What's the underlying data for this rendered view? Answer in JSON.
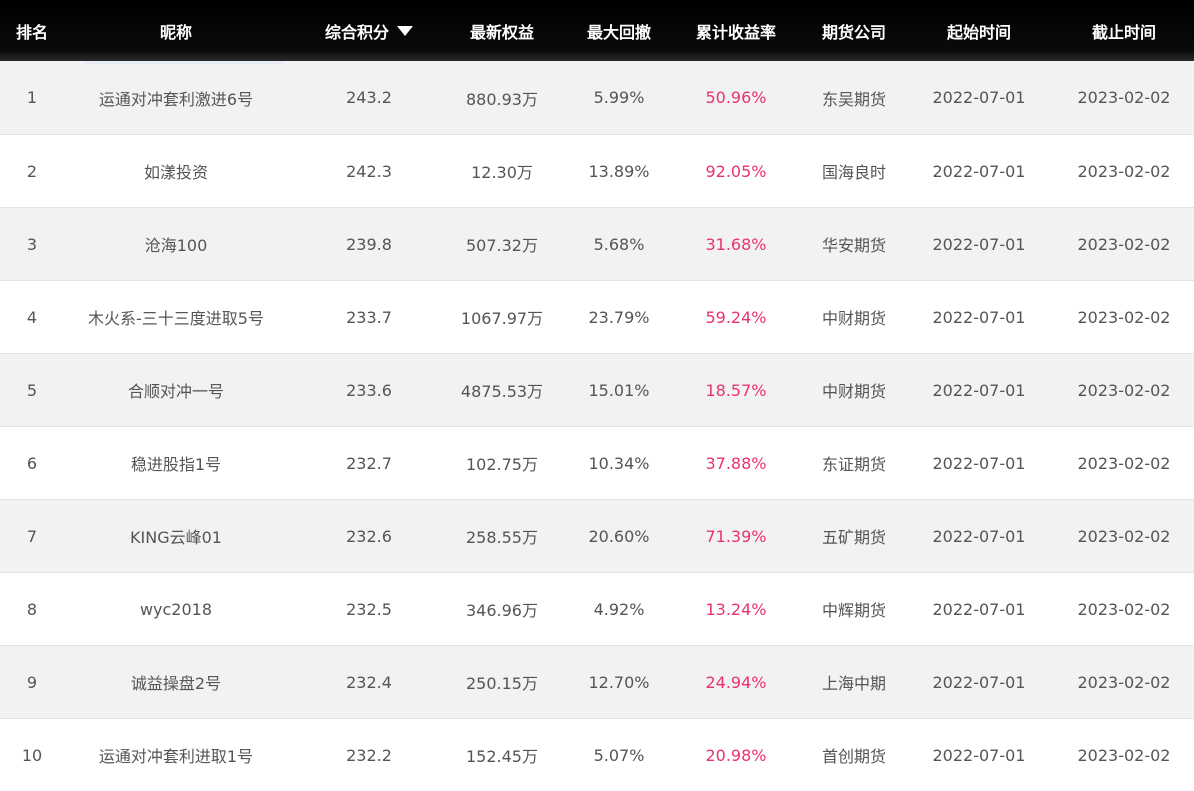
{
  "columns": {
    "rank": "排名",
    "nickname": "昵称",
    "score": "综合积分",
    "equity": "最新权益",
    "max_drawdown": "最大回撤",
    "cum_return": "累计收益率",
    "broker": "期货公司",
    "start": "起始时间",
    "end": "截止时间"
  },
  "icons": {
    "sort": "sort-desc-triangle-icon"
  },
  "colors": {
    "header_bg": "#000000",
    "return_text": "#e8336d",
    "stripe": "#f2f2f2"
  },
  "rows": [
    {
      "rank": "1",
      "nickname": "运通对冲套利激进6号",
      "score": "243.2",
      "equity": "880.93万",
      "max_drawdown": "5.99%",
      "cum_return": "50.96%",
      "broker": "东吴期货",
      "start": "2022-07-01",
      "end": "2023-02-02"
    },
    {
      "rank": "2",
      "nickname": "如漾投资",
      "score": "242.3",
      "equity": "12.30万",
      "max_drawdown": "13.89%",
      "cum_return": "92.05%",
      "broker": "国海良时",
      "start": "2022-07-01",
      "end": "2023-02-02"
    },
    {
      "rank": "3",
      "nickname": "沧海100",
      "score": "239.8",
      "equity": "507.32万",
      "max_drawdown": "5.68%",
      "cum_return": "31.68%",
      "broker": "华安期货",
      "start": "2022-07-01",
      "end": "2023-02-02"
    },
    {
      "rank": "4",
      "nickname": "木火系-三十三度进取5号",
      "score": "233.7",
      "equity": "1067.97万",
      "max_drawdown": "23.79%",
      "cum_return": "59.24%",
      "broker": "中财期货",
      "start": "2022-07-01",
      "end": "2023-02-02"
    },
    {
      "rank": "5",
      "nickname": "合顺对冲一号",
      "score": "233.6",
      "equity": "4875.53万",
      "max_drawdown": "15.01%",
      "cum_return": "18.57%",
      "broker": "中财期货",
      "start": "2022-07-01",
      "end": "2023-02-02"
    },
    {
      "rank": "6",
      "nickname": "稳进股指1号",
      "score": "232.7",
      "equity": "102.75万",
      "max_drawdown": "10.34%",
      "cum_return": "37.88%",
      "broker": "东证期货",
      "start": "2022-07-01",
      "end": "2023-02-02"
    },
    {
      "rank": "7",
      "nickname": "KING云峰01",
      "score": "232.6",
      "equity": "258.55万",
      "max_drawdown": "20.60%",
      "cum_return": "71.39%",
      "broker": "五矿期货",
      "start": "2022-07-01",
      "end": "2023-02-02"
    },
    {
      "rank": "8",
      "nickname": "wyc2018",
      "score": "232.5",
      "equity": "346.96万",
      "max_drawdown": "4.92%",
      "cum_return": "13.24%",
      "broker": "中辉期货",
      "start": "2022-07-01",
      "end": "2023-02-02"
    },
    {
      "rank": "9",
      "nickname": "诚益操盘2号",
      "score": "232.4",
      "equity": "250.15万",
      "max_drawdown": "12.70%",
      "cum_return": "24.94%",
      "broker": "上海中期",
      "start": "2022-07-01",
      "end": "2023-02-02"
    },
    {
      "rank": "10",
      "nickname": "运通对冲套利进取1号",
      "score": "232.2",
      "equity": "152.45万",
      "max_drawdown": "5.07%",
      "cum_return": "20.98%",
      "broker": "首创期货",
      "start": "2022-07-01",
      "end": "2023-02-02"
    }
  ]
}
